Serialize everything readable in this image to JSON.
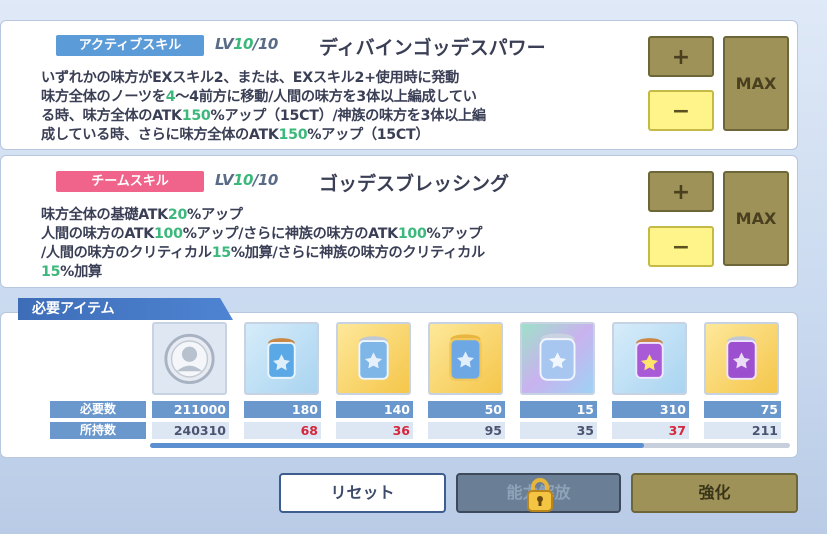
{
  "skill1": {
    "tag": "アクティブスキル",
    "lv_prefix": "LV",
    "lv_current": "10",
    "lv_max": "/10",
    "name": "ディバインゴッデスパワー",
    "desc": {
      "l1": "いずれかの味方がEXスキル2、または、EXスキル2+使用時に発動",
      "l2a": "味方全体のノーツを",
      "l2b": "4",
      "l2c": "〜4前方に移動/人間の味方を3体以上編成してい",
      "l3a": "る時、味方全体のATK",
      "l3b": "150",
      "l3c": "%アップ（15CT）/神族の味方を3体以上編",
      "l4a": "成している時、さらに味方全体のATK",
      "l4b": "150",
      "l4c": "%アップ（15CT）"
    },
    "plus": "+",
    "minus": "−",
    "max": "MAX"
  },
  "skill2": {
    "tag": "チームスキル",
    "lv_prefix": "LV",
    "lv_current": "10",
    "lv_max": "/10",
    "name": "ゴッデスブレッシング",
    "desc": {
      "l1a": "味方全体の基礎ATK",
      "l1b": "20",
      "l1c": "%アップ",
      "l2a": "人間の味方のATK",
      "l2b": "100",
      "l2c": "%アップ/さらに神族の味方のATK",
      "l2d": "100",
      "l2e": "%アップ",
      "l3a": "/人間の味方のクリティカル",
      "l3b": "15",
      "l3c": "%加算/さらに神族の味方のクリティカル",
      "l4a": "15",
      "l4b": "%加算"
    },
    "plus": "+",
    "minus": "−",
    "max": "MAX"
  },
  "items": {
    "header": "必要アイテム",
    "required_label": "必要数",
    "owned_label": "所持数",
    "list": [
      {
        "icon": "silver-coin-icon",
        "required": "211000",
        "owned": "240310",
        "short": false
      },
      {
        "icon": "blue-jar-small-icon",
        "required": "180",
        "owned": "68",
        "short": true
      },
      {
        "icon": "blue-jar-medium-icon",
        "required": "140",
        "owned": "36",
        "short": true
      },
      {
        "icon": "blue-jar-large-icon",
        "required": "50",
        "owned": "95",
        "short": false
      },
      {
        "icon": "rainbow-jar-icon",
        "required": "15",
        "owned": "35",
        "short": false
      },
      {
        "icon": "purple-jar-small-icon",
        "required": "310",
        "owned": "37",
        "short": true
      },
      {
        "icon": "purple-jar-medium-icon",
        "required": "75",
        "owned": "211",
        "short": false
      }
    ]
  },
  "buttons": {
    "reset": "リセット",
    "unlock": "能力解放",
    "enhance": "強化"
  },
  "colors": {
    "accent_green": "#3cb87c",
    "active_tag": "#5a9bd8",
    "team_tag": "#f0648c",
    "short_red": "#d5263c"
  }
}
